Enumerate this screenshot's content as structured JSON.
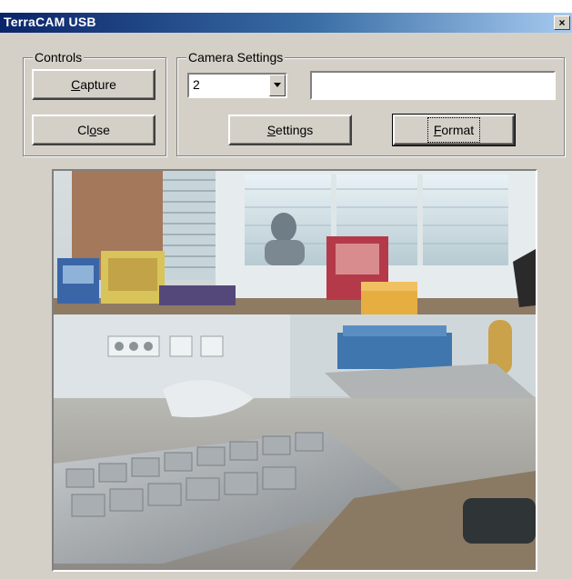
{
  "window": {
    "title": "TerraCAM USB",
    "close_glyph": "✕"
  },
  "controls": {
    "label": "Controls",
    "capture_label": "Capture",
    "close_label": "Close"
  },
  "camera_settings": {
    "label": "Camera Settings",
    "selected_value": "2",
    "text_value": "",
    "settings_label": "Settings",
    "format_label": "Format"
  },
  "preview": {
    "icon": "camera-feed"
  }
}
